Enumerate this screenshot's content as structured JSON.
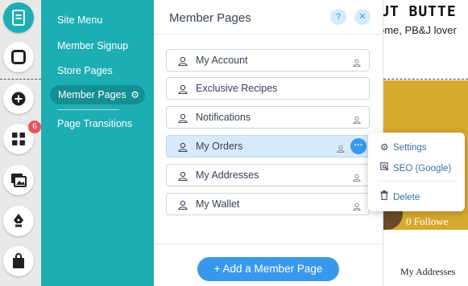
{
  "rail": {
    "badge_count": "6"
  },
  "menu": {
    "items": [
      {
        "label": "Site Menu"
      },
      {
        "label": "Member Signup"
      },
      {
        "label": "Store Pages"
      },
      {
        "label": "Member Pages"
      },
      {
        "label": "Page Transitions"
      }
    ]
  },
  "panel": {
    "title": "Member Pages",
    "help_glyph": "?",
    "close_glyph": "✕",
    "pages": [
      {
        "label": "My Account"
      },
      {
        "label": "Exclusive Recipes"
      },
      {
        "label": "Notifications"
      },
      {
        "label": "My Orders"
      },
      {
        "label": "My Addresses"
      },
      {
        "label": "My Wallet"
      }
    ],
    "more_glyph": "···",
    "add_button": "+ Add a Member Page"
  },
  "dropdown": {
    "items": [
      {
        "label": "Settings"
      },
      {
        "label": "SEO (Google)"
      },
      {
        "label": "Delete"
      }
    ]
  },
  "preview": {
    "title": "UT BUTTE",
    "subtitle": "ome, PB&J lover",
    "followers": "0 Followe",
    "addresses": "My Addresses"
  },
  "colors": {
    "teal": "#1daeb4",
    "teal_active": "#138f94",
    "blue": "#3899ec",
    "selected_row": "#d7eafc",
    "gold": "#d6a92f",
    "badge_red": "#e8555d"
  }
}
